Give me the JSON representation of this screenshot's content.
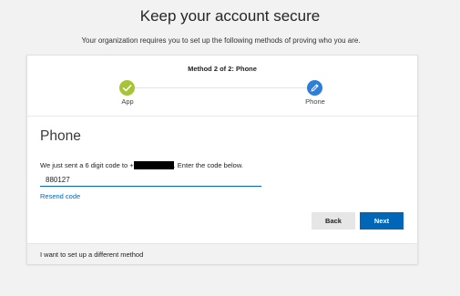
{
  "header": {
    "title": "Keep your account secure",
    "subtitle": "Your organization requires you to set up the following methods of proving who you are."
  },
  "progress": {
    "label": "Method 2 of 2: Phone",
    "steps": [
      {
        "label": "App",
        "state": "complete",
        "icon": "checkmark-icon",
        "color": "#a6c436"
      },
      {
        "label": "Phone",
        "state": "current",
        "icon": "pencil-icon",
        "color": "#2c7ed7"
      }
    ]
  },
  "phone_section": {
    "title": "Phone",
    "instruction_prefix": "We just sent a 6 digit code to +",
    "instruction_suffix": ". Enter the code below.",
    "code_value": "880127",
    "resend_label": "Resend code"
  },
  "buttons": {
    "back_label": "Back",
    "next_label": "Next"
  },
  "footer": {
    "alternate_method_label": "I want to set up a different method"
  },
  "colors": {
    "accent": "#0067b8",
    "step_complete": "#a6c436",
    "step_current": "#2c7ed7"
  }
}
